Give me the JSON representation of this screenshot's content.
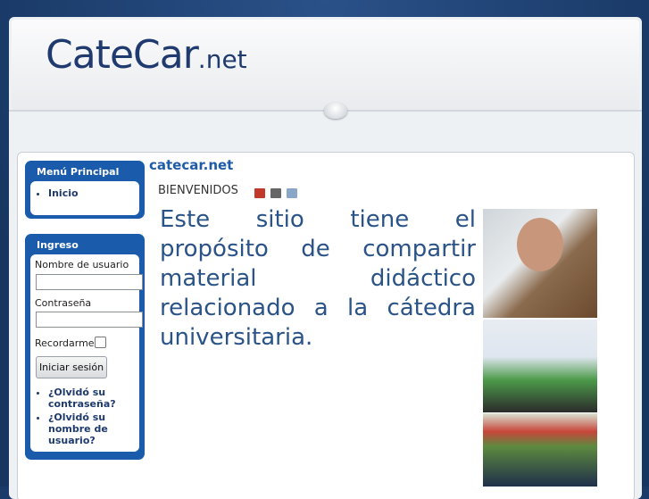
{
  "header": {
    "logo_main": "CateCar",
    "logo_suffix": ".net"
  },
  "sidebar": {
    "menu": {
      "title": "Menú Principal",
      "items": [
        {
          "label": "Inicio"
        }
      ]
    },
    "login": {
      "title": "Ingreso",
      "username_label": "Nombre de usuario",
      "username_value": "",
      "password_label": "Contraseña",
      "password_value": "",
      "remember_label": "Recordarme",
      "remember_checked": false,
      "submit_label": "Iniciar sesión",
      "links": [
        {
          "label": "¿Olvidó su contraseña?"
        },
        {
          "label": "¿Olvidó su nombre de usuario?"
        }
      ]
    }
  },
  "main": {
    "title": "catecar.net",
    "article_title": "BIENVENIDOS",
    "icons": [
      "pdf-icon",
      "print-icon",
      "email-icon"
    ],
    "body": "Este sitio tiene el propósito de compartir material didáctico relacionado a la cátedra universitaria."
  }
}
